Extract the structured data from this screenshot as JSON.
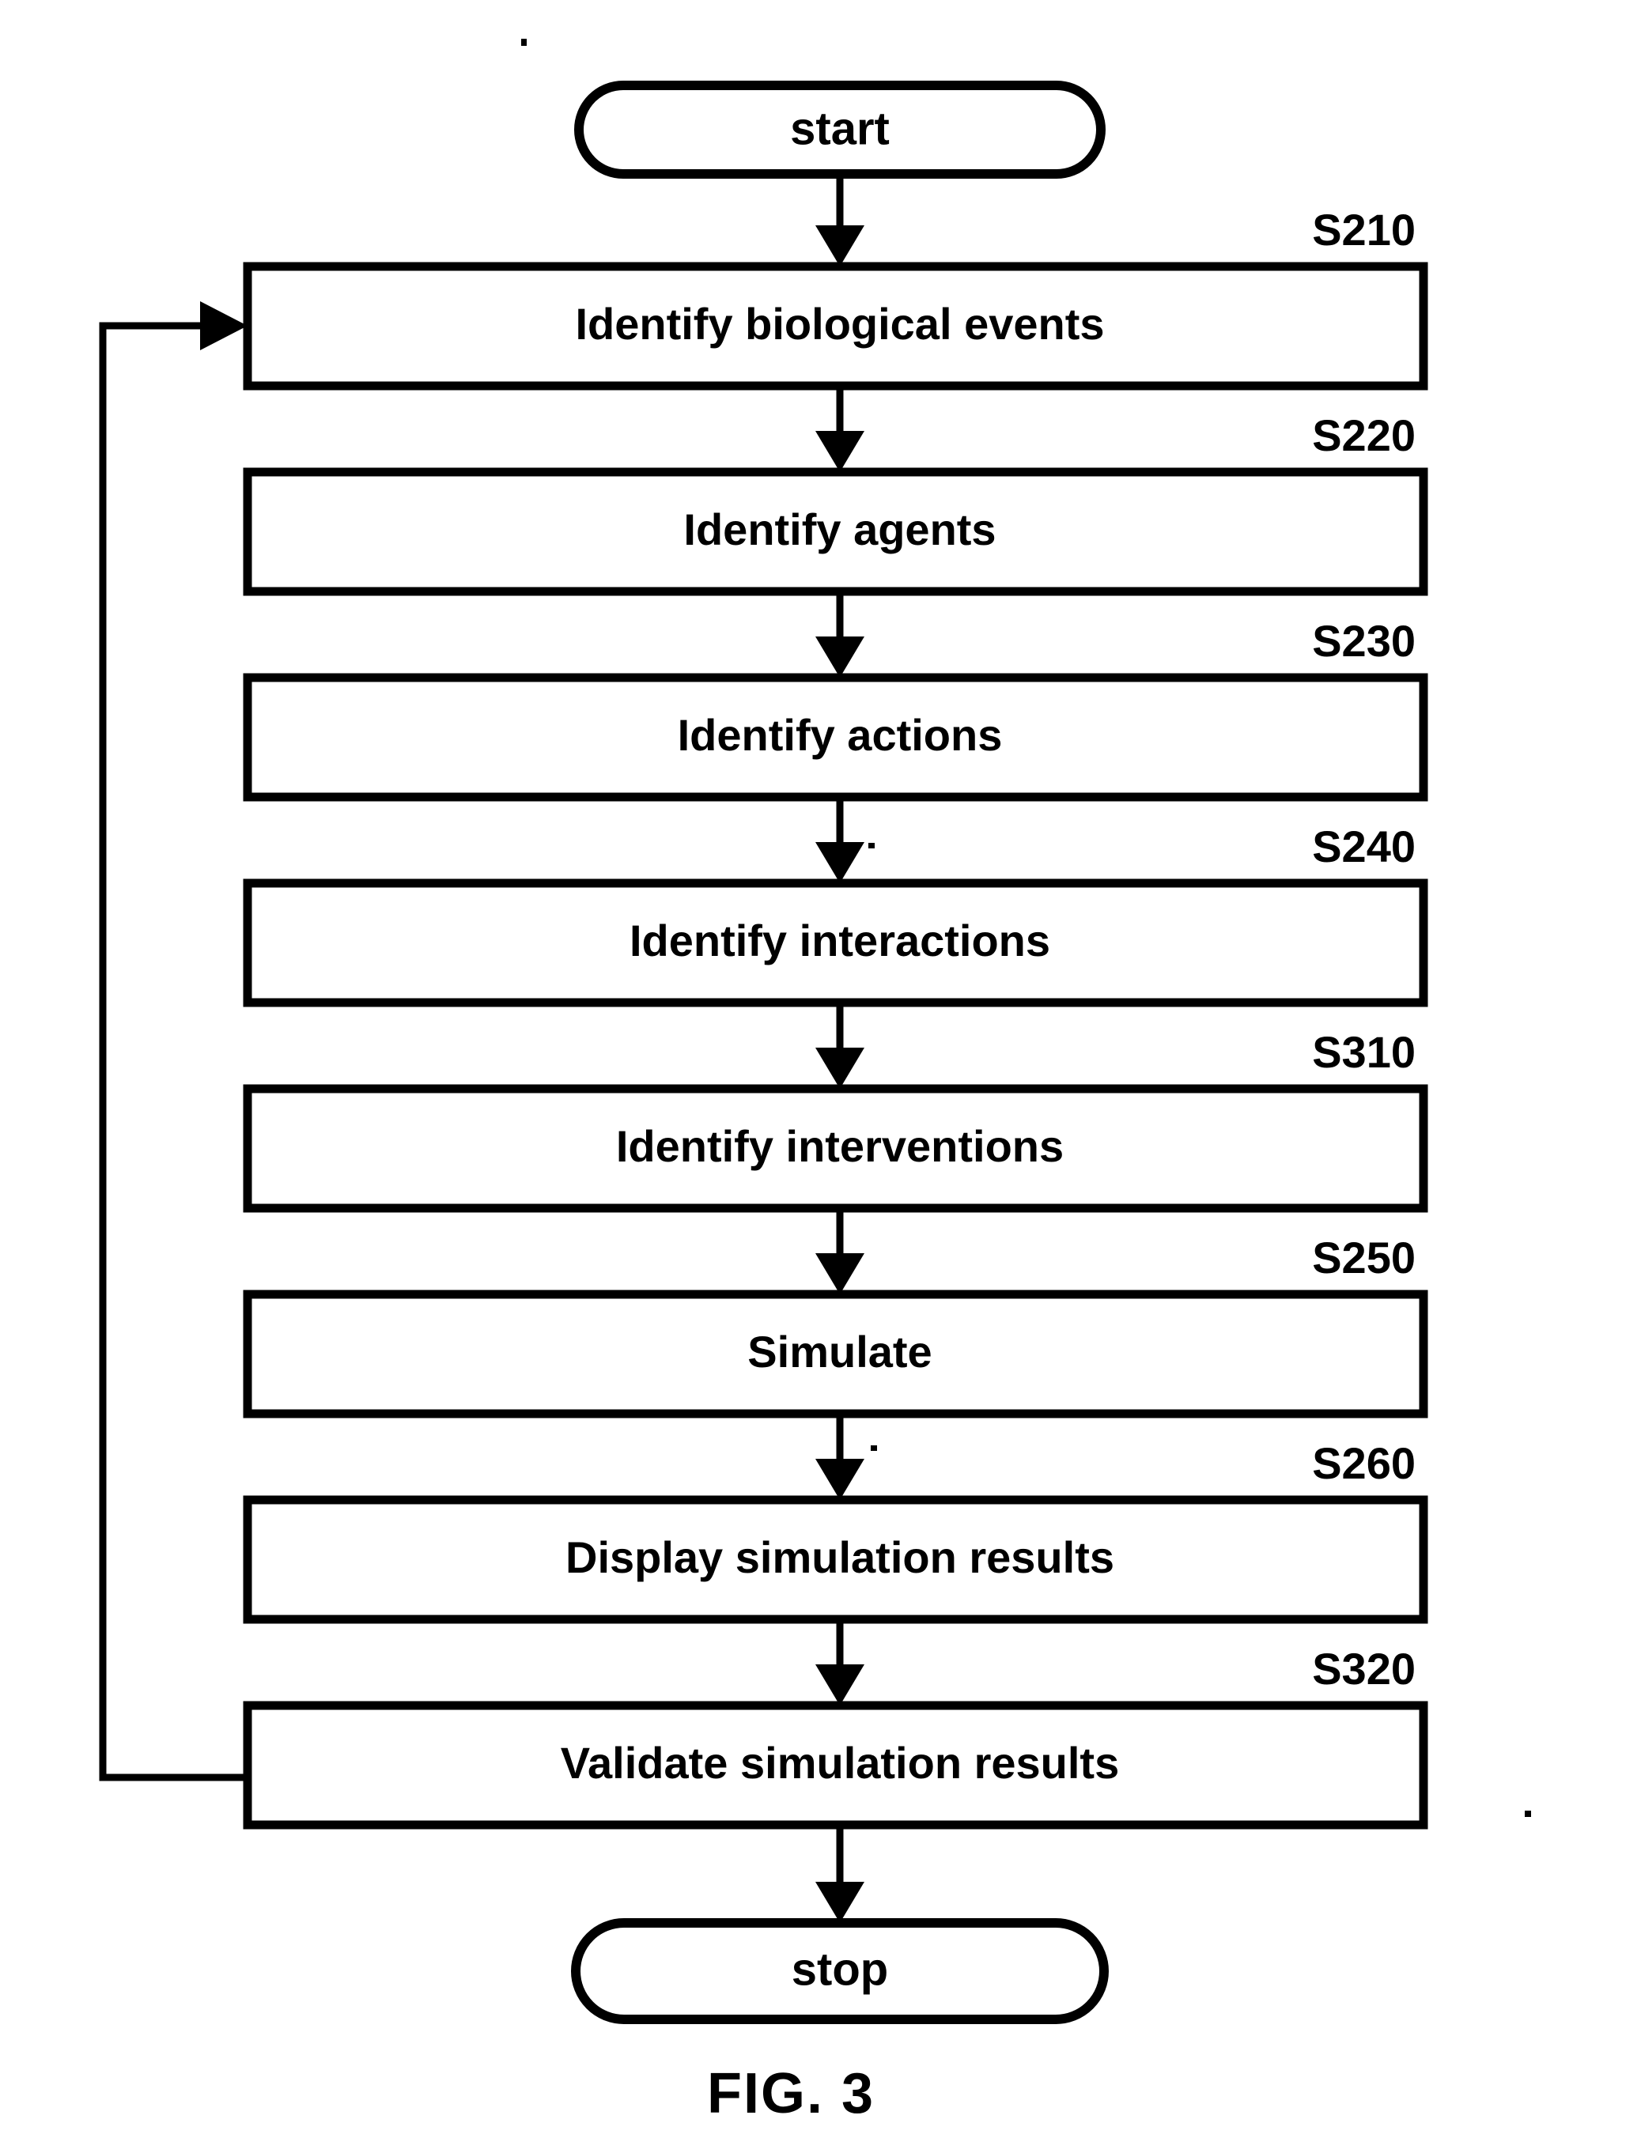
{
  "figure": {
    "caption": "FIG. 3",
    "terminals": {
      "start": "start",
      "stop": "stop"
    },
    "steps": [
      {
        "id": "S210",
        "label": "Identify biological events"
      },
      {
        "id": "S220",
        "label": "Identify agents"
      },
      {
        "id": "S230",
        "label": "Identify actions"
      },
      {
        "id": "S240",
        "label": "Identify interactions"
      },
      {
        "id": "S310",
        "label": "Identify interventions"
      },
      {
        "id": "S250",
        "label": "Simulate"
      },
      {
        "id": "S260",
        "label": "Display simulation results"
      },
      {
        "id": "S320",
        "label": "Validate simulation results"
      }
    ],
    "feedback": {
      "from": "S320",
      "to": "S210"
    },
    "colors": {
      "ink": "#000000",
      "paper": "#ffffff"
    }
  }
}
